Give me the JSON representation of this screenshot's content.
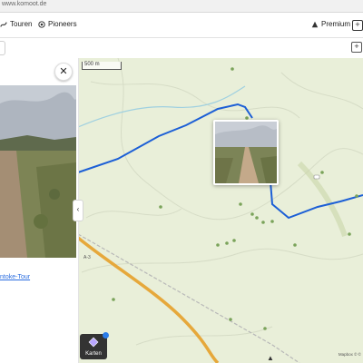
{
  "browser": {
    "url": "www.komoot.de"
  },
  "nav": {
    "tours_label": "Touren",
    "pioneers_label": "Pioneers",
    "premium_label": "Premium",
    "add_label": "+"
  },
  "panel": {
    "close_label": "✕",
    "tour_link": "ntoke-Tour",
    "collapse_label": "‹"
  },
  "map": {
    "scale_label": "500 m",
    "road_label": "A-3",
    "map_type_label": "Karten",
    "credit": "Mapbox © ©",
    "compass_label": "▲"
  },
  "colors": {
    "route": "#1c5fd6",
    "map_bg": "#e9efd9",
    "poi": "#7aa35a",
    "highway": "#e6a83b"
  }
}
